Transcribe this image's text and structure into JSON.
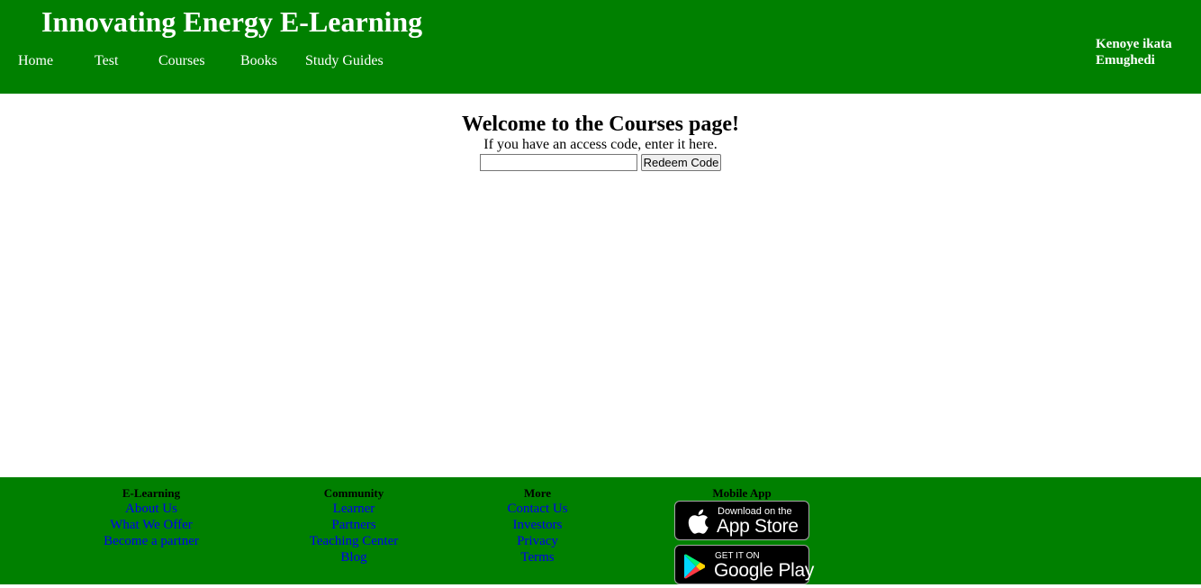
{
  "header": {
    "site_title": "Innovating Energy E-Learning",
    "nav": [
      "Home",
      "Test",
      "Courses",
      "Books",
      "Study Guides"
    ],
    "user_name": "Kenoye ikata Emughedi",
    "background_color": "#008000"
  },
  "main": {
    "heading": "Welcome to the Courses page!",
    "subtitle": "If you have an access code, enter it here.",
    "code_input_value": "",
    "redeem_button_label": "Redeem Code"
  },
  "footer": {
    "columns": [
      {
        "heading": "E-Learning",
        "links": [
          "About Us",
          "What We Offer",
          "Become a partner"
        ]
      },
      {
        "heading": "Community",
        "links": [
          "Learner",
          "Partners",
          "Teaching Center",
          "Blog"
        ]
      },
      {
        "heading": "More",
        "links": [
          "Contact Us",
          "Investors",
          "Privacy",
          "Terms"
        ]
      }
    ],
    "mobile_app": {
      "heading": "Mobile App",
      "app_store": {
        "small_text": "Download on the",
        "big_text": "App Store",
        "icon": "apple-icon"
      },
      "google_play": {
        "small_text": "GET IT ON",
        "big_text": "Google Play",
        "icon": "google-play-icon"
      }
    },
    "link_color": "#0000ee"
  }
}
